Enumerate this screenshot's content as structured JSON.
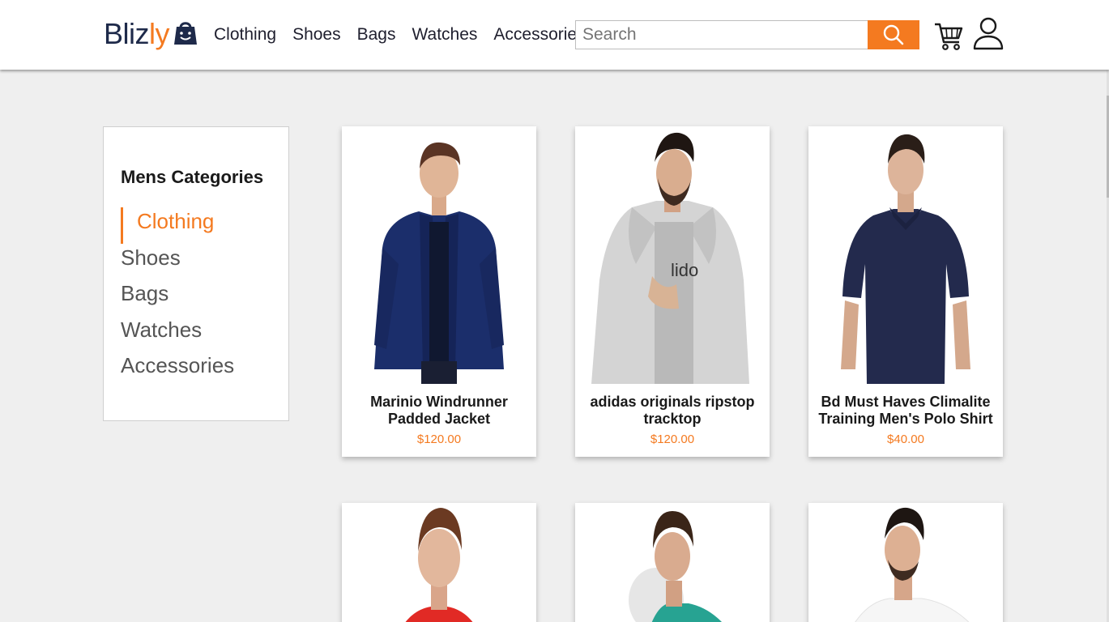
{
  "brand": {
    "name_part1": "Bliz",
    "name_part2": "ly",
    "primary_color": "#1e2a4a",
    "accent_color": "#f47a20"
  },
  "nav": {
    "items": [
      "Clothing",
      "Shoes",
      "Bags",
      "Watches",
      "Accessories"
    ]
  },
  "search": {
    "placeholder": "Search",
    "value": ""
  },
  "sidebar": {
    "title": "Mens Categories",
    "items": [
      {
        "label": "Clothing",
        "active": true
      },
      {
        "label": "Shoes",
        "active": false
      },
      {
        "label": "Bags",
        "active": false
      },
      {
        "label": "Watches",
        "active": false
      },
      {
        "label": "Accessories",
        "active": false
      }
    ]
  },
  "products": [
    {
      "name": "Marinio Windrunner Padded Jacket",
      "price": "$120.00",
      "garment": "navy-jacket"
    },
    {
      "name": "adidas originals ripstop tracktop",
      "price": "$120.00",
      "garment": "grey-hoodie"
    },
    {
      "name": "Bd Must Haves Climalite Training Men's Polo Shirt",
      "price": "$40.00",
      "garment": "navy-polo"
    },
    {
      "name": "",
      "price": "",
      "garment": "red-tshirt"
    },
    {
      "name": "",
      "price": "",
      "garment": "teal-tshirt"
    },
    {
      "name": "",
      "price": "",
      "garment": "white-tshirt"
    }
  ]
}
